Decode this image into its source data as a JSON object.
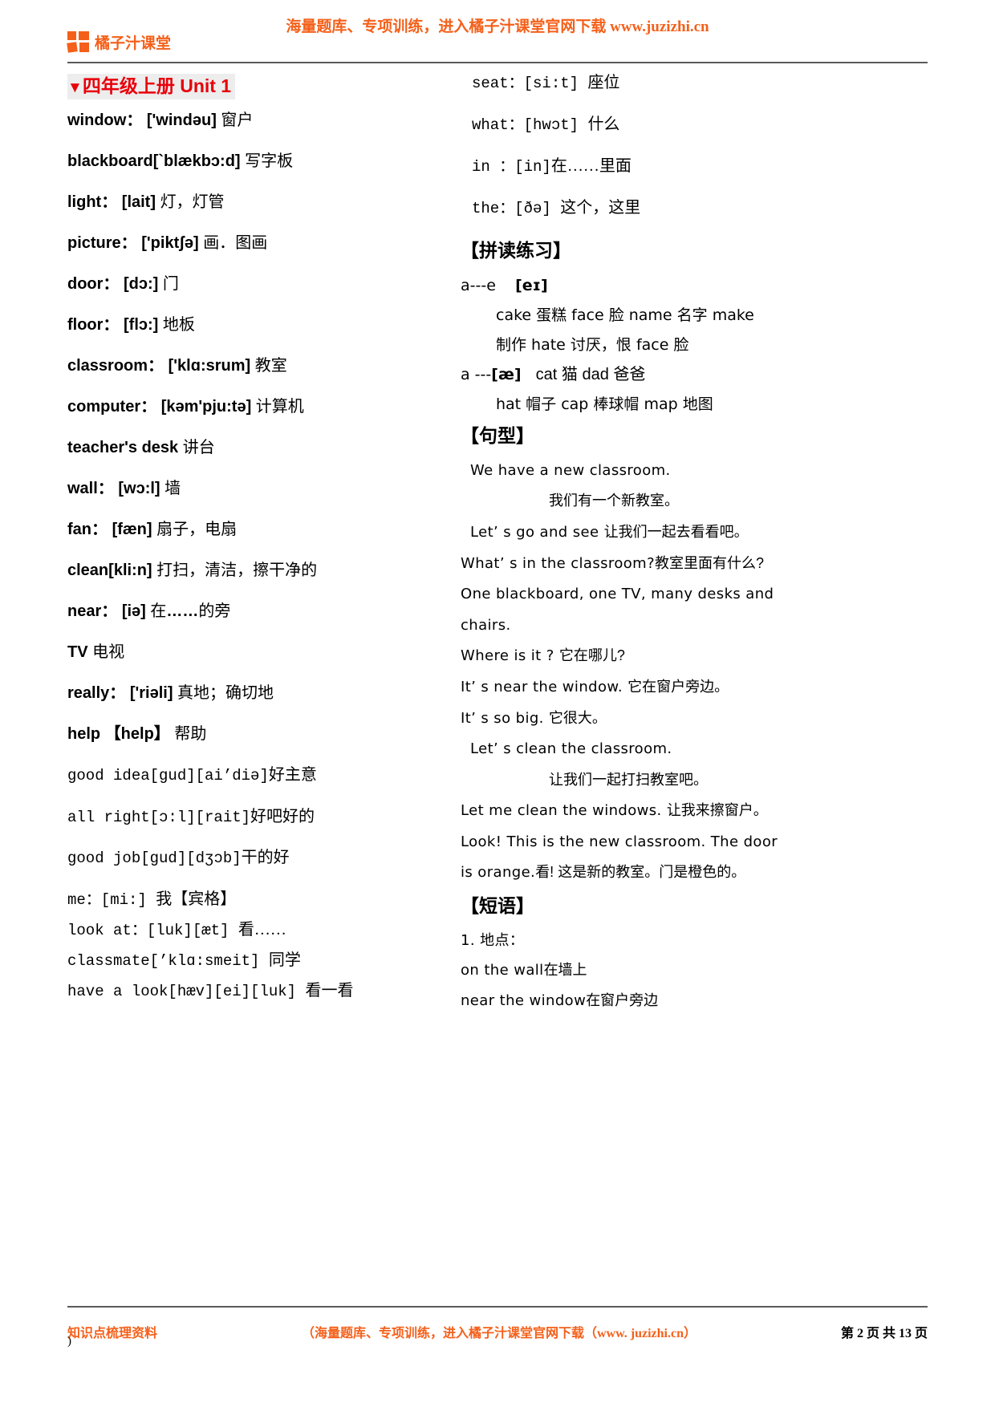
{
  "header": {
    "brand_name": "橘子汁课堂",
    "slogan": "海量题库、专项训练，进入橘子汁课堂官网下载 www.juzizhi.cn",
    "brand_color": "#F4601A"
  },
  "unit": {
    "caret": "▼",
    "title": "四年级上册 Unit 1",
    "title_color": "#e8000b",
    "highlight_color": "#ededed"
  },
  "left_column": {
    "vocabulary": [
      {
        "en": "window：",
        "ipa": "['windəu]",
        "cn": "窗户"
      },
      {
        "en": "blackboard",
        "ipa": "[`blækbɔ:d]",
        "cn": "写字板"
      },
      {
        "en": "light：",
        "ipa": "[lait]",
        "cn": "灯，灯管"
      },
      {
        "en": "picture：",
        "ipa": "['piktʃə]",
        "cn": "画．图画"
      },
      {
        "en": "door：",
        "ipa": "[dɔ:]",
        "cn": "门"
      },
      {
        "en": "floor：",
        "ipa": "[flɔ:]",
        "cn": "地板"
      },
      {
        "en": "classroom：",
        "ipa": "['klɑ:srum]",
        "cn": "教室"
      },
      {
        "en": "computer：",
        "ipa": "[kəm'pju:tə]",
        "cn": "计算机"
      },
      {
        "en": "teacher's desk",
        "ipa": "",
        "cn": "讲台"
      },
      {
        "en": "wall：",
        "ipa": "[wɔ:l]",
        "cn": "墙"
      },
      {
        "en": "fan：",
        "ipa": "[fæn]",
        "cn": "扇子，电扇"
      },
      {
        "en": "clean",
        "ipa": "[kli:n]",
        "cn": "打扫，清洁，擦干净的"
      },
      {
        "en": "near：",
        "ipa": "[iə]",
        "cn_pre": "在",
        "cn_dots": "……",
        "cn_post": "的旁"
      },
      {
        "en": "TV",
        "ipa": "",
        "cn": "电视"
      },
      {
        "en": "really：",
        "ipa": "['riəli]",
        "cn": "真地；确切地"
      },
      {
        "en": "help",
        "ipa": "【help】",
        "cn": "帮助"
      }
    ],
    "phrases": [
      {
        "text": "good idea[gud][ai’diə]",
        "cn": "好主意"
      },
      {
        "text": "all right[ɔ:l][rait]",
        "cn": "好吧好的"
      },
      {
        "text": "good job[gud][dʒɔb]",
        "cn": "干的好"
      },
      {
        "text": "me：[mi:]",
        "cn": "我【宾格】"
      },
      {
        "text": "look at：[luk][æt]",
        "cn": "看……"
      },
      {
        "text": "classmate[’klɑ:smeit]",
        "cn": "同学"
      },
      {
        "text": "have a look[hæv][ei][luk]",
        "cn": "看一看"
      }
    ]
  },
  "right_column": {
    "words": [
      {
        "text": "seat：[si:t]",
        "cn": "座位"
      },
      {
        "text": "what：[hwɔt]",
        "cn": "什么"
      },
      {
        "text": "in ：[in]",
        "cn": "在……里面"
      },
      {
        "text": "the：[ðə]",
        "cn": "这个，这里"
      }
    ],
    "phonics_heading": "【拼读练习】",
    "phonics": [
      {
        "rule": "a---e",
        "ipa": "[eɪ]"
      },
      {
        "items": "cake 蛋糕    face 脸   name 名字   make"
      },
      {
        "items": "制作 hate 讨厌，恨 face 脸"
      },
      {
        "rule": "a ---",
        "ipa": "[æ]",
        "items": "cat 猫   dad 爸爸"
      },
      {
        "items": "hat 帽子   cap 棒球帽 map 地图"
      }
    ],
    "sentence_heading": "【句型】",
    "sentences": [
      {
        "en": "We have a new classroom.",
        "indent": 1
      },
      {
        "cn": "我们有一个新教室。",
        "indent": 2
      },
      {
        "en": "Let’ s go and see",
        "cn": "让我们一起去看看吧。",
        "indent": 1
      },
      {
        "en": "What’ s in the classroom?",
        "cn": "教室里面有什么?",
        "indent": 0
      },
      {
        "en": "One  blackboard, one TV,  many desks and",
        "indent": 0
      },
      {
        "en": "chairs.",
        "indent": 0
      },
      {
        "en": "Where  is  it ?",
        "cn": "它在哪儿?",
        "indent": 0
      },
      {
        "en": "It’ s near the window.",
        "cn": "它在窗户旁边。",
        "indent": 0
      },
      {
        "en": "It’ s so big.",
        "cn": "它很大。",
        "indent": 0
      },
      {
        "en": "Let’ s clean the classroom.",
        "indent": 1
      },
      {
        "cn": "让我们一起打扫教室吧。",
        "indent": 2
      },
      {
        "en": "Let me clean the windows.",
        "cn": "让我来擦窗户。",
        "indent": 0
      },
      {
        "en": "Look! This is the new classroom.  The door",
        "indent": 0
      },
      {
        "en": "is orange.",
        "cn": "看! 这是新的教室。门是橙色的。",
        "indent": 0
      }
    ],
    "phrase_heading": "【短语】",
    "phrase_list": [
      {
        "text": "1. 地点："
      },
      {
        "text": "on the wall",
        "cn": "在墙上"
      },
      {
        "text": "near the window",
        "cn": "在窗户旁边"
      }
    ]
  },
  "footer": {
    "left": "知识点梳理资料",
    "center": "（海量题库、专项训练，进入橘子汁课堂官网下载（www. juzizhi.cn）",
    "right": "第 2 页 共 13 页",
    "stray": ")"
  }
}
